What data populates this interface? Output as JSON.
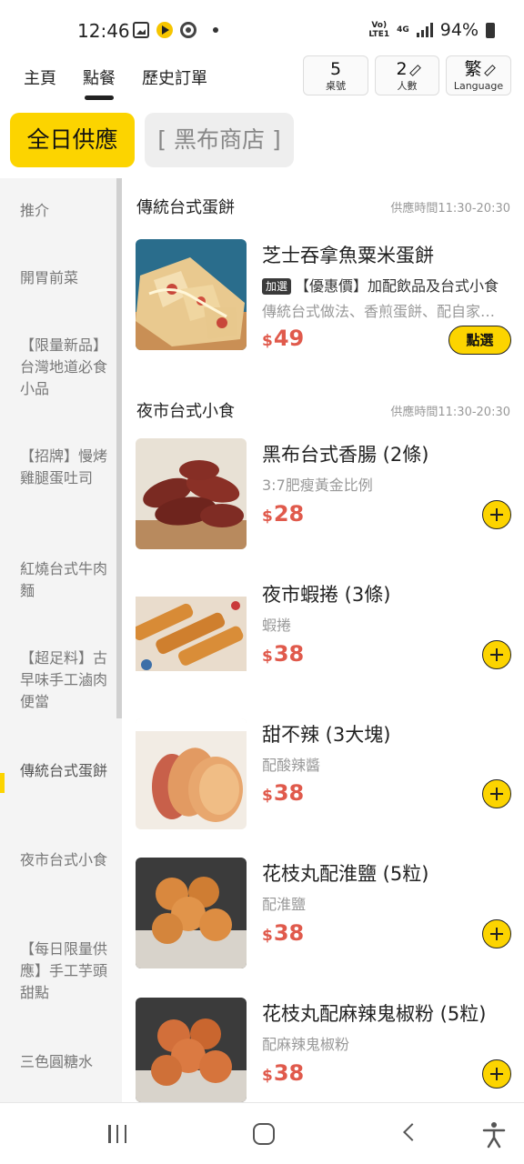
{
  "status_bar": {
    "time": "12:46",
    "network_top": "Vo)",
    "network_bottom": "LTE1",
    "network_4g": "4G",
    "battery": "94%"
  },
  "nav": {
    "tabs": [
      "主頁",
      "點餐",
      "歷史訂單"
    ],
    "active_tab": "點餐"
  },
  "header_buttons": {
    "table": {
      "value": "5",
      "label": "桌號"
    },
    "people": {
      "value": "2",
      "label": "人數"
    },
    "language": {
      "value": "繁",
      "label": "Language"
    }
  },
  "store_chips": {
    "all_day": "全日供應",
    "store": "[ 黑布商店 ]"
  },
  "sidebar": {
    "items": [
      "推介",
      "開胃前菜",
      "【限量新品】台灣地道必食小品",
      "【招牌】慢烤雞腿蛋吐司",
      "紅燒台式牛肉麵",
      "【超足料】古早味手工滷肉便當",
      "傳統台式蛋餅",
      "夜市台式小食",
      "【每日限量供應】手工芋頭甜點",
      "三色圓糖水"
    ],
    "active": "傳統台式蛋餅"
  },
  "sections": [
    {
      "title": "傳統台式蛋餅",
      "hours": "供應時間11:30-20:30",
      "items": [
        {
          "name": "芝士吞拿魚粟米蛋餅",
          "promo_badge": "加選",
          "promo": "【優惠價】加配飲品及台式小食",
          "desc": "傳統台式做法、香煎蛋餅、配自家醬汁",
          "currency": "$",
          "price": "49",
          "action": "點選"
        }
      ]
    },
    {
      "title": "夜市台式小食",
      "hours": "供應時間11:30-20:30",
      "items": [
        {
          "name": "黑布台式香腸 (2條)",
          "desc": "3:7肥瘦黃金比例",
          "currency": "$",
          "price": "28"
        },
        {
          "name": "夜市蝦捲 (3條)",
          "desc": "蝦捲",
          "currency": "$",
          "price": "38"
        },
        {
          "name": "甜不辣 (3大塊)",
          "desc": "配酸辣醬",
          "currency": "$",
          "price": "38"
        },
        {
          "name": "花枝丸配淮鹽 (5粒)",
          "desc": "配淮鹽",
          "currency": "$",
          "price": "38"
        },
        {
          "name": "花枝丸配麻辣鬼椒粉 (5粒)",
          "desc": "配麻辣鬼椒粉",
          "currency": "$",
          "price": "38"
        }
      ]
    }
  ],
  "colors": {
    "accent": "#fcd400",
    "price": "#e05a4c",
    "sidebar_bg": "#f4f4f4"
  },
  "icons": [
    "gallery-icon",
    "play-icon",
    "chrome-icon",
    "signal-icon",
    "battery-icon",
    "pencil-icon",
    "add-icon",
    "recent-apps-icon",
    "home-icon",
    "back-icon",
    "accessibility-icon"
  ]
}
